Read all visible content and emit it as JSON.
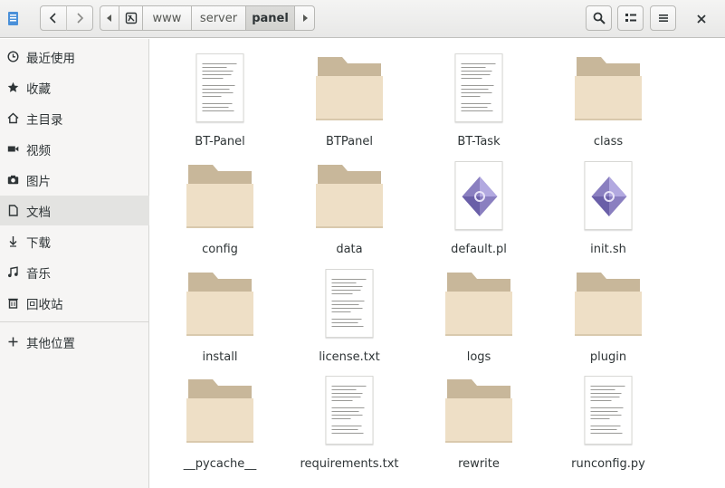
{
  "header": {
    "path": [
      "www",
      "server",
      "panel"
    ],
    "active_segment": "panel",
    "tools": [
      "search-icon",
      "view-toggle-icon",
      "hamburger-menu-icon",
      "close-icon"
    ]
  },
  "sidebar": {
    "items": [
      {
        "label": "最近使用",
        "icon": "clock-icon"
      },
      {
        "label": "收藏",
        "icon": "star-icon"
      },
      {
        "label": "主目录",
        "icon": "home-icon"
      },
      {
        "label": "视频",
        "icon": "video-icon"
      },
      {
        "label": "图片",
        "icon": "camera-icon"
      },
      {
        "label": "文档",
        "icon": "document-icon"
      },
      {
        "label": "下载",
        "icon": "download-icon"
      },
      {
        "label": "音乐",
        "icon": "music-icon"
      },
      {
        "label": "回收站",
        "icon": "trash-icon"
      },
      {
        "label": "其他位置",
        "icon": "plus-icon"
      }
    ],
    "selected": "文档"
  },
  "files": [
    {
      "name": "BT-Panel",
      "kind": "text"
    },
    {
      "name": "BTPanel",
      "kind": "folder"
    },
    {
      "name": "BT-Task",
      "kind": "text"
    },
    {
      "name": "class",
      "kind": "folder"
    },
    {
      "name": "config",
      "kind": "folder"
    },
    {
      "name": "data",
      "kind": "folder"
    },
    {
      "name": "default.pl",
      "kind": "script"
    },
    {
      "name": "init.sh",
      "kind": "script"
    },
    {
      "name": "install",
      "kind": "folder"
    },
    {
      "name": "license.txt",
      "kind": "text"
    },
    {
      "name": "logs",
      "kind": "folder"
    },
    {
      "name": "plugin",
      "kind": "folder"
    },
    {
      "name": "__pycache__",
      "kind": "folder"
    },
    {
      "name": "requirements.txt",
      "kind": "text"
    },
    {
      "name": "rewrite",
      "kind": "folder"
    },
    {
      "name": "runconfig.py",
      "kind": "text"
    }
  ],
  "colors": {
    "folder_back": "#c8b79a",
    "folder_front": "#eedfc6",
    "accent": "#4a90d9"
  }
}
